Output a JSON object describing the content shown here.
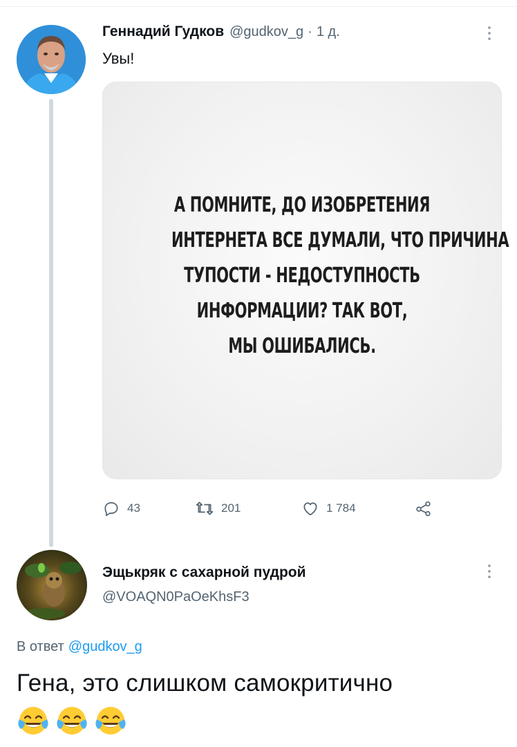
{
  "tweet1": {
    "author_name": "Геннадий Гудков",
    "handle": "@gudkov_g",
    "separator": "·",
    "time": "1 д.",
    "text": "Увы!",
    "media_lines": [
      "А ПОМНИТЕ, ДО ИЗОБРЕТЕНИЯ",
      "ИНТЕРНЕТА ВСЕ ДУМАЛИ, ЧТО ПРИЧИНА",
      "ТУПОСТИ - НЕДОСТУПНОСТЬ",
      "ИНФОРМАЦИИ? ТАК ВОТ,",
      "МЫ ОШИБАЛИСЬ."
    ],
    "replies": "43",
    "retweets": "201",
    "likes": "1 784"
  },
  "tweet2": {
    "author_name": "Эщькряк с сахарной пудрой",
    "handle": "@VOAQN0PaOeKhsF3",
    "reply_prefix": "В ответ",
    "reply_mention": "@gudkov_g",
    "text": "Гена, это слишком самокритично",
    "emojis": [
      "face-with-tears-of-joy",
      "face-with-tears-of-joy",
      "face-with-tears-of-joy"
    ]
  },
  "colors": {
    "text": "#0f1419",
    "secondary": "#536471",
    "link": "#1d9bf0",
    "thread_line": "#cfd9de"
  }
}
